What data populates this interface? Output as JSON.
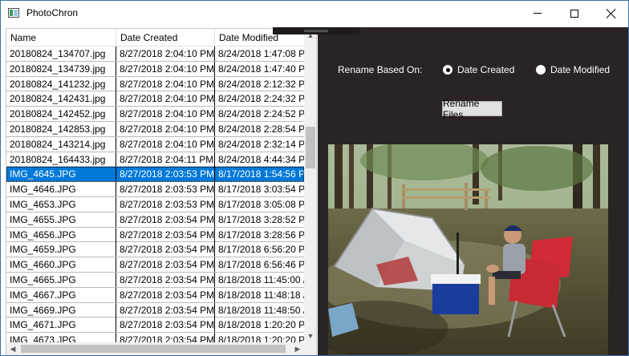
{
  "window": {
    "title": "PhotoChron"
  },
  "list": {
    "columns": [
      "Name",
      "Date Created",
      "Date Modified"
    ],
    "rows": [
      {
        "name": "20180824_134707.jpg",
        "created": "8/27/2018 2:04:10 PM",
        "modified": "8/24/2018 1:47:08 P"
      },
      {
        "name": "20180824_134739.jpg",
        "created": "8/27/2018 2:04:10 PM",
        "modified": "8/24/2018 1:47:40 P"
      },
      {
        "name": "20180824_141232.jpg",
        "created": "8/27/2018 2:04:10 PM",
        "modified": "8/24/2018 2:12:32 P"
      },
      {
        "name": "20180824_142431.jpg",
        "created": "8/27/2018 2:04:10 PM",
        "modified": "8/24/2018 2:24:32 P"
      },
      {
        "name": "20180824_142452.jpg",
        "created": "8/27/2018 2:04:10 PM",
        "modified": "8/24/2018 2:24:52 P"
      },
      {
        "name": "20180824_142853.jpg",
        "created": "8/27/2018 2:04:10 PM",
        "modified": "8/24/2018 2:28:54 P"
      },
      {
        "name": "20180824_143214.jpg",
        "created": "8/27/2018 2:04:10 PM",
        "modified": "8/24/2018 2:32:14 P"
      },
      {
        "name": "20180824_164433.jpg",
        "created": "8/27/2018 2:04:11 PM",
        "modified": "8/24/2018 4:44:34 P"
      },
      {
        "name": "IMG_4645.JPG",
        "created": "8/27/2018 2:03:53 PM",
        "modified": "8/17/2018 1:54:56 P"
      },
      {
        "name": "IMG_4646.JPG",
        "created": "8/27/2018 2:03:53 PM",
        "modified": "8/17/2018 3:03:54 P"
      },
      {
        "name": "IMG_4653.JPG",
        "created": "8/27/2018 2:03:53 PM",
        "modified": "8/17/2018 3:05:08 P"
      },
      {
        "name": "IMG_4655.JPG",
        "created": "8/27/2018 2:03:54 PM",
        "modified": "8/17/2018 3:28:52 P"
      },
      {
        "name": "IMG_4656.JPG",
        "created": "8/27/2018 2:03:54 PM",
        "modified": "8/17/2018 3:28:56 P"
      },
      {
        "name": "IMG_4659.JPG",
        "created": "8/27/2018 2:03:54 PM",
        "modified": "8/17/2018 6:56:20 P"
      },
      {
        "name": "IMG_4660.JPG",
        "created": "8/27/2018 2:03:54 PM",
        "modified": "8/17/2018 6:56:46 P"
      },
      {
        "name": "IMG_4665.JPG",
        "created": "8/27/2018 2:03:54 PM",
        "modified": "8/18/2018 11:45:00 /"
      },
      {
        "name": "IMG_4667.JPG",
        "created": "8/27/2018 2:03:54 PM",
        "modified": "8/18/2018 11:48:18 /"
      },
      {
        "name": "IMG_4669.JPG",
        "created": "8/27/2018 2:03:54 PM",
        "modified": "8/18/2018 11:48:50 /"
      },
      {
        "name": "IMG_4671.JPG",
        "created": "8/27/2018 2:03:54 PM",
        "modified": "8/18/2018 1:20:20 P"
      },
      {
        "name": "IMG_4673.JPG",
        "created": "8/27/2018 2:03:54 PM",
        "modified": "8/18/2018 1:20:20 P"
      }
    ],
    "selected_index": 8
  },
  "controls": {
    "rename_label": "Rename Based On:",
    "option_created": "Date Created",
    "option_modified": "Date Modified",
    "selected_option": "Date Created",
    "rename_button": "Rename Files"
  },
  "colors": {
    "selection": "#0078d7",
    "right_pane_bg": "#2a2424"
  }
}
